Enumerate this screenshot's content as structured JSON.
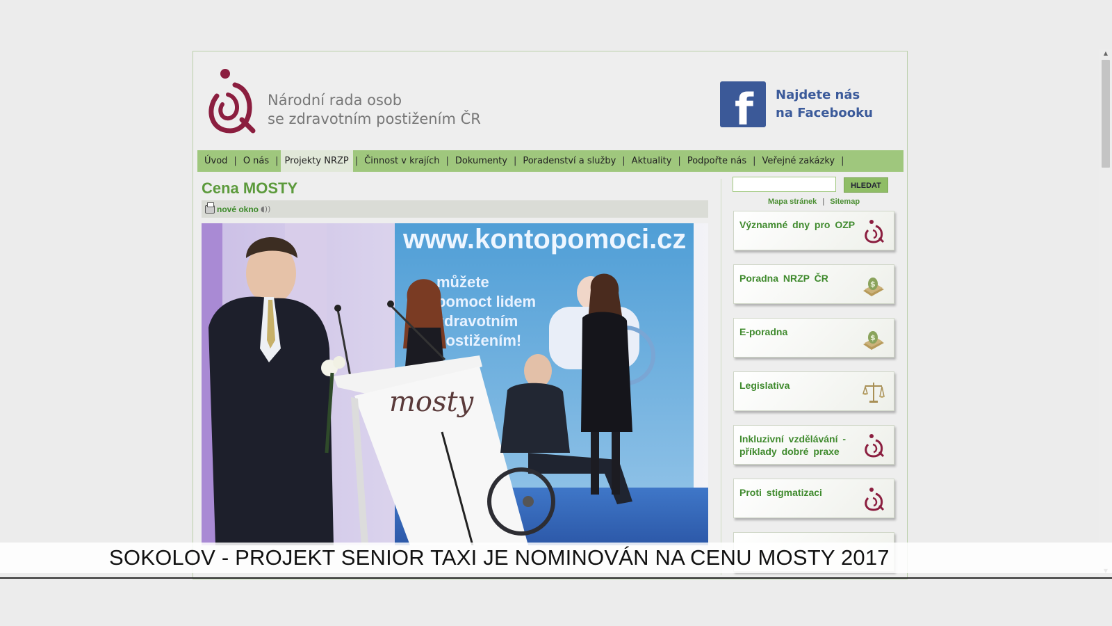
{
  "header": {
    "org_line1": "Národní rada osob",
    "org_line2": "se zdravotním postižením ČR",
    "facebook_line1": "Najdete nás",
    "facebook_line2": "na Facebooku"
  },
  "nav": {
    "items": [
      "Úvod",
      "O nás",
      "Projekty NRZP",
      "Činnost v krajích",
      "Dokumenty",
      "Poradenství a služby",
      "Aktuality",
      "Podpořte nás",
      "Veřejné zakázky"
    ],
    "separator": "|",
    "active": "Projekty NRZP"
  },
  "main": {
    "title": "Cena MOSTY",
    "toolbar_link": "nové okno",
    "photo": {
      "banner_text": "www.kontopomoci.cz",
      "slogan": [
        "můžete",
        "pomoct lidem",
        "zdravotním",
        "postižením!"
      ],
      "lectern_text": "mosty"
    }
  },
  "sidebar": {
    "search_button": "HLEDAT",
    "sitemap_link": "Mapa stránek",
    "sitemap_en_link": "Sitemap",
    "link_separator": "|",
    "boxes": [
      {
        "label": "Významné dny pro OZP",
        "icon": "nrzp-logo-icon"
      },
      {
        "label": "Poradna NRZP ČR",
        "icon": "money-icon"
      },
      {
        "label": "E-poradna",
        "icon": "money-icon"
      },
      {
        "label": "Legislativa",
        "icon": "scales-icon"
      },
      {
        "label": "Inkluzivní vzdělávání - příklady dobré praxe",
        "icon": "nrzp-logo-icon"
      },
      {
        "label": "Proti stigmatizaci",
        "icon": "nrzp-logo-icon"
      }
    ]
  },
  "caption": {
    "text": "SOKOLOV - PROJEKT SENIOR TAXI JE NOMINOVÁN NA CENU MOSTY 2017"
  },
  "colors": {
    "nav_green": "#9fc77d",
    "link_green": "#3f8a2d",
    "brand_red": "#8b1e3f",
    "facebook_blue": "#3b5998"
  }
}
